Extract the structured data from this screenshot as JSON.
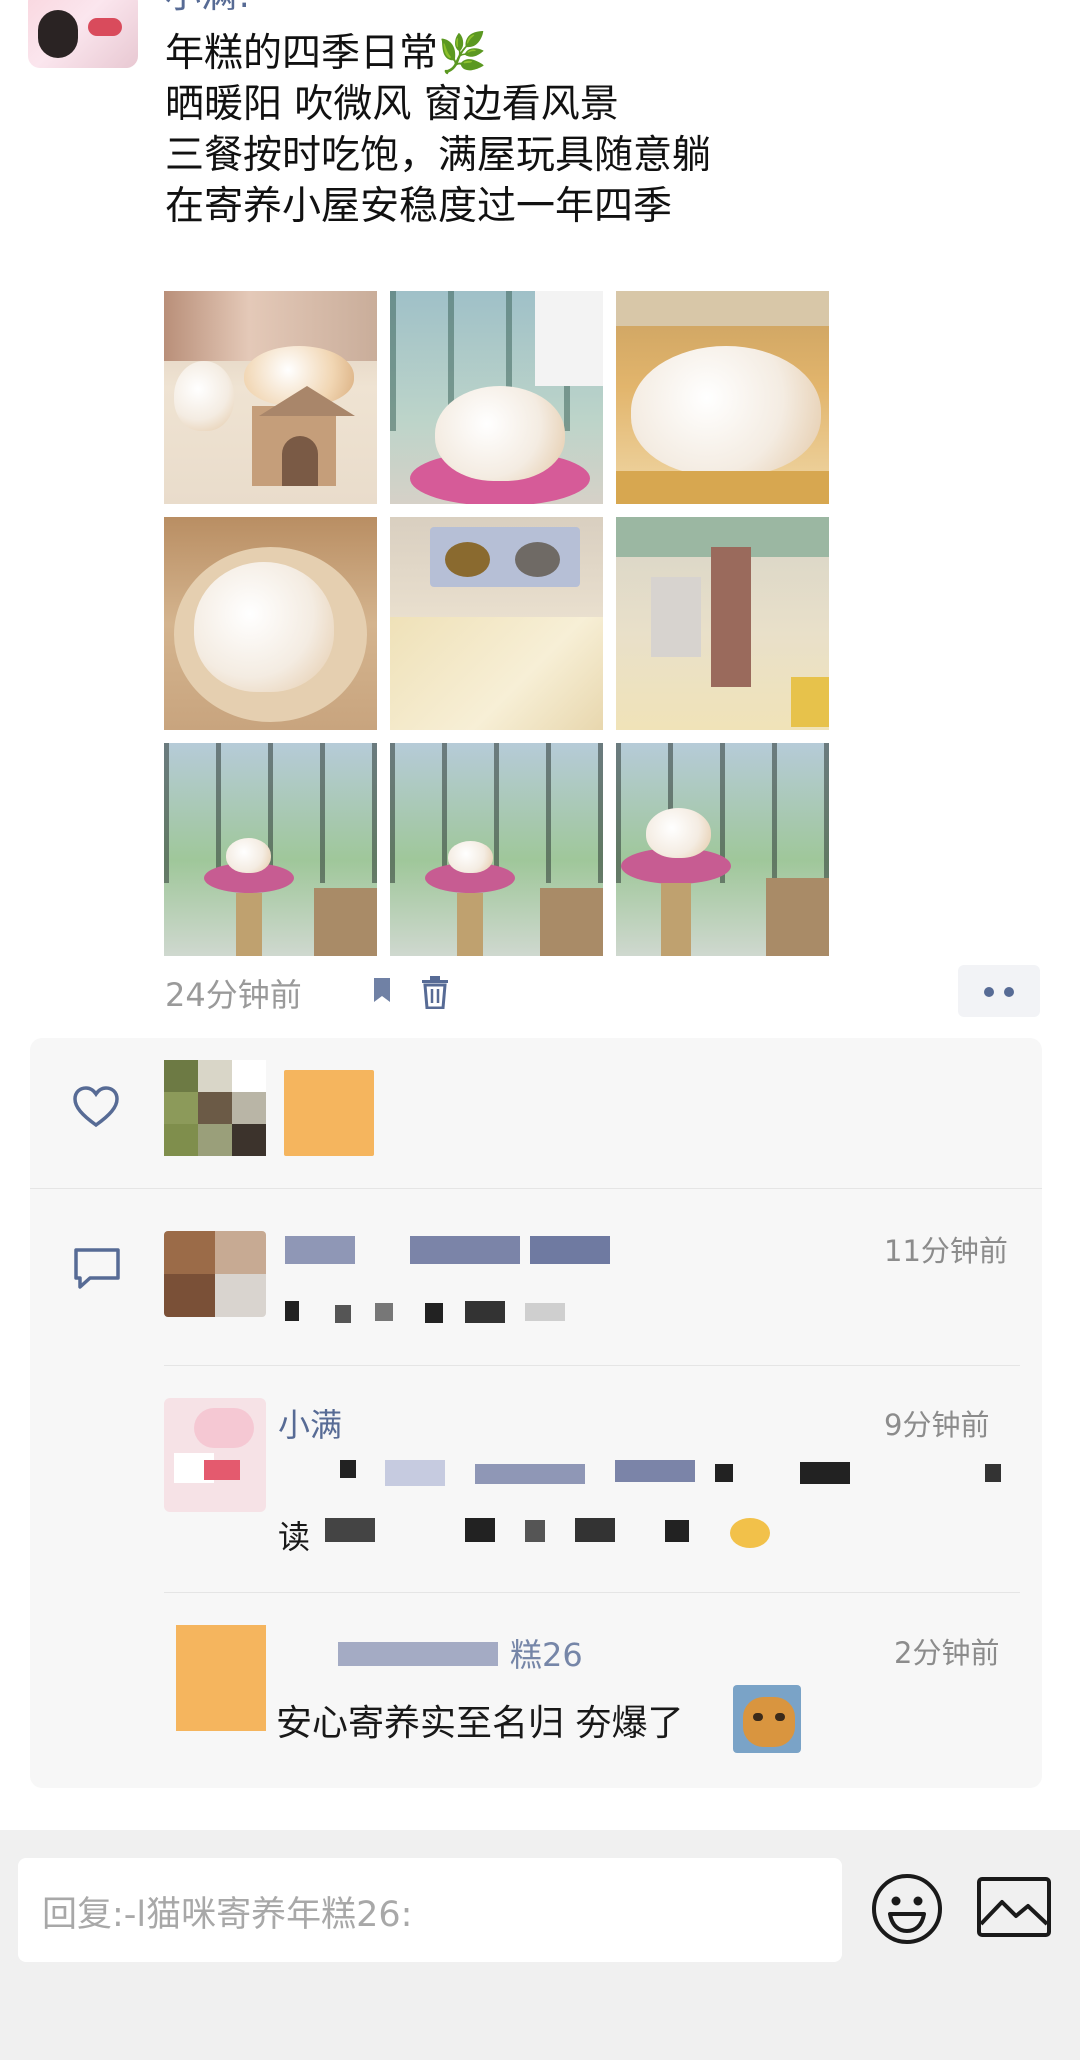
{
  "post": {
    "author_name": "小满!",
    "lines": [
      "年糕的四季日常🌿",
      "晒暖阳 吹微风 窗边看风景",
      "三餐按时吃饱，满屋玩具随意躺",
      "在寄养小屋安稳度过一年四季"
    ],
    "time": "24分钟前",
    "photo_count": 9
  },
  "icons": {
    "favorite": "bookmark-icon",
    "delete": "trash-icon",
    "more": "more-dots-icon",
    "like": "heart-icon",
    "comment": "comment-icon",
    "emoji": "smiley-icon",
    "image": "image-icon"
  },
  "comments": [
    {
      "time": "11分钟前"
    },
    {
      "name": "小满",
      "time": "9分钟前",
      "text_prefix": "读"
    },
    {
      "time": "2分钟前",
      "name_suffix": "糕26",
      "text": "安心寄养实至名归 夯爆了"
    }
  ],
  "reply": {
    "placeholder": "回复:-l猫咪寄养年糕26:"
  },
  "colors": {
    "link": "#576b95",
    "panel": "#f7f7f7",
    "reply_bar": "#f0f0f0"
  }
}
